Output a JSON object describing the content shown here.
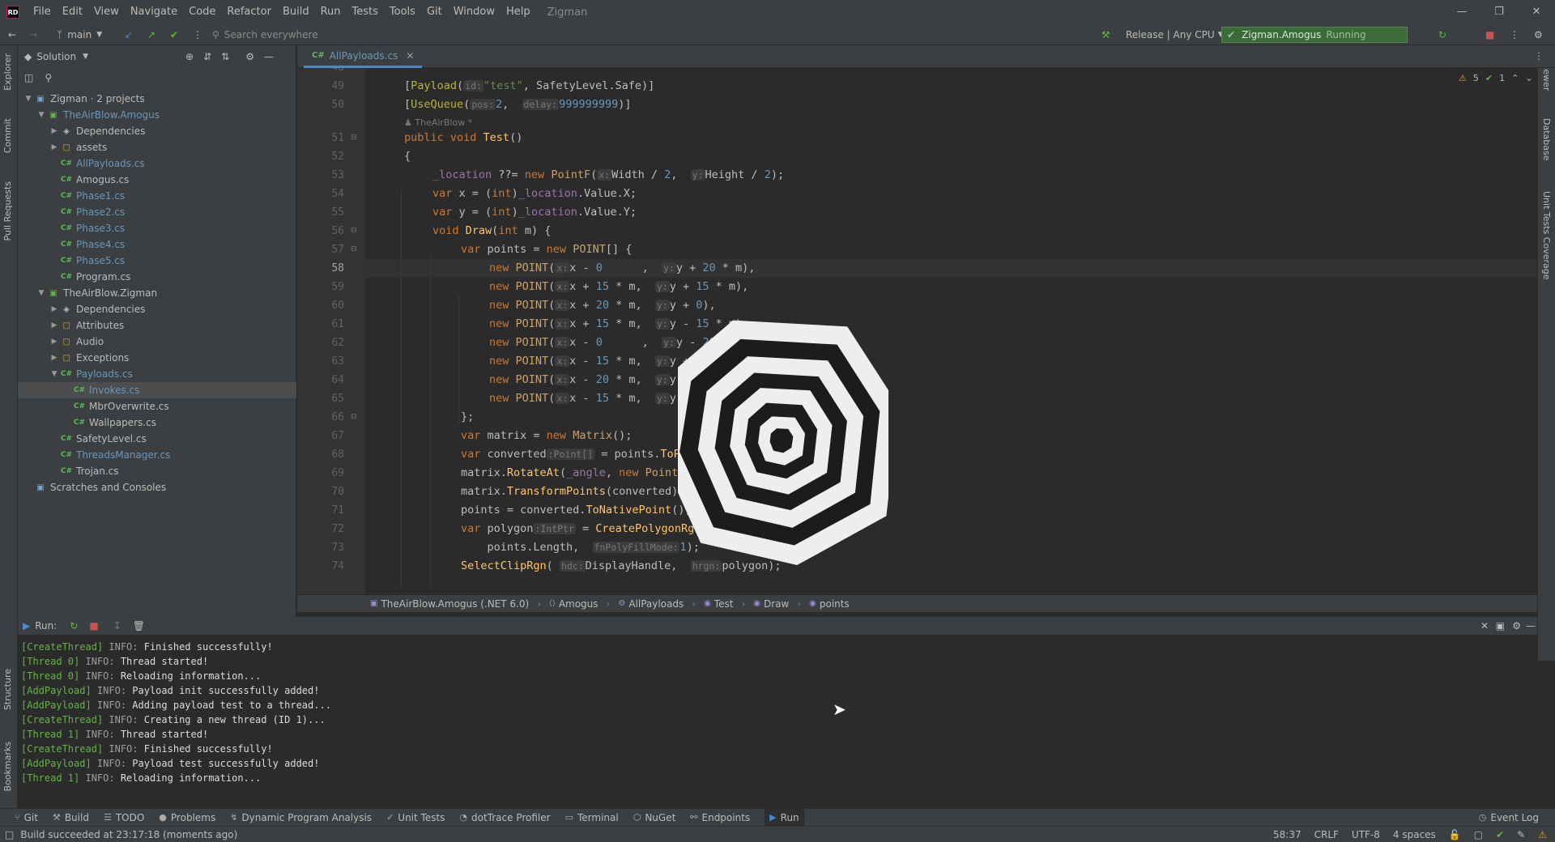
{
  "app": {
    "logo_text": "RD",
    "project_name": "Zigman"
  },
  "menu": [
    "File",
    "Edit",
    "View",
    "Navigate",
    "Code",
    "Refactor",
    "Build",
    "Run",
    "Tests",
    "Tools",
    "Git",
    "Window",
    "Help"
  ],
  "toolbar": {
    "branch": "main",
    "search_placeholder": "Search everywhere",
    "build_config": "Release | Any CPU",
    "run_config": "Zigman.Amogus",
    "run_state": "Running"
  },
  "left_strip": [
    "Explorer",
    "Commit",
    "Pull Requests",
    "Structure",
    "Bookmarks"
  ],
  "right_strip": [
    "IL Viewer",
    "Database",
    "Unit Tests Coverage"
  ],
  "solution": {
    "title": "Solution",
    "tree": [
      {
        "label": "Zigman · 2 projects",
        "depth": 0,
        "icon": "solution",
        "expanded": true
      },
      {
        "label": "TheAirBlow.Amogus",
        "depth": 1,
        "icon": "project",
        "expanded": true,
        "color": "blue"
      },
      {
        "label": "Dependencies",
        "depth": 2,
        "icon": "deps",
        "expanded": false
      },
      {
        "label": "assets",
        "depth": 2,
        "icon": "folder",
        "expanded": false
      },
      {
        "label": "AllPayloads.cs",
        "depth": 2,
        "icon": "cs",
        "color": "blue"
      },
      {
        "label": "Amogus.cs",
        "depth": 2,
        "icon": "cs"
      },
      {
        "label": "Phase1.cs",
        "depth": 2,
        "icon": "cs",
        "color": "blue"
      },
      {
        "label": "Phase2.cs",
        "depth": 2,
        "icon": "cs",
        "color": "blue"
      },
      {
        "label": "Phase3.cs",
        "depth": 2,
        "icon": "cs",
        "color": "blue"
      },
      {
        "label": "Phase4.cs",
        "depth": 2,
        "icon": "cs",
        "color": "blue"
      },
      {
        "label": "Phase5.cs",
        "depth": 2,
        "icon": "cs",
        "color": "blue"
      },
      {
        "label": "Program.cs",
        "depth": 2,
        "icon": "cs"
      },
      {
        "label": "TheAirBlow.Zigman",
        "depth": 1,
        "icon": "project",
        "expanded": true
      },
      {
        "label": "Dependencies",
        "depth": 2,
        "icon": "deps",
        "expanded": false
      },
      {
        "label": "Attributes",
        "depth": 2,
        "icon": "folder",
        "expanded": false
      },
      {
        "label": "Audio",
        "depth": 2,
        "icon": "folder",
        "expanded": false
      },
      {
        "label": "Exceptions",
        "depth": 2,
        "icon": "folder",
        "expanded": false
      },
      {
        "label": "Payloads.cs",
        "depth": 2,
        "icon": "cs",
        "expanded": true,
        "color": "blue"
      },
      {
        "label": "Invokes.cs",
        "depth": 3,
        "icon": "cs",
        "selected": true,
        "color": "blue"
      },
      {
        "label": "MbrOverwrite.cs",
        "depth": 3,
        "icon": "cs"
      },
      {
        "label": "Wallpapers.cs",
        "depth": 3,
        "icon": "cs"
      },
      {
        "label": "SafetyLevel.cs",
        "depth": 2,
        "icon": "cs"
      },
      {
        "label": "ThreadsManager.cs",
        "depth": 2,
        "icon": "cs",
        "color": "blue"
      },
      {
        "label": "Trojan.cs",
        "depth": 2,
        "icon": "cs"
      },
      {
        "label": "Scratches and Consoles",
        "depth": 0,
        "icon": "scratch"
      }
    ]
  },
  "editor": {
    "tab": "AllPayloads.cs",
    "tab_prefix": "C#",
    "inspections": {
      "warnings": "5",
      "ok": "1"
    },
    "current_line": 58,
    "author_hint": "TheAirBlow *",
    "lines": [
      {
        "n": 48,
        "html": ""
      },
      {
        "n": 49,
        "html": "[<span class='attr'>Payload</span>(<span class='hint'>id:</span><span class='str'>\"test\"</span>, SafetyLevel.Safe)]",
        "indent": 1
      },
      {
        "n": 50,
        "html": "[<span class='attr'>UseQueue</span>(<span class='hint'>pos:</span><span class='num'>2</span>,  <span class='hint'>delay:</span><span class='num'>999999999</span>)]",
        "indent": 1
      },
      {
        "n": null,
        "html": "<span class='authorhint'>&#9823; TheAirBlow *</span>",
        "indent": 1,
        "small": true
      },
      {
        "n": 51,
        "html": "<span class='kw'>public void</span> <span class='fn'>Test</span>()",
        "indent": 1
      },
      {
        "n": 52,
        "html": "{",
        "indent": 1
      },
      {
        "n": 53,
        "html": "<span class='field'>_location</span> ??= <span class='kw'>new</span> <span class='tp'>PointF</span>(<span class='hint'>x:</span>Width / <span class='num'>2</span>,  <span class='hint'>y:</span>Height / <span class='num'>2</span>);",
        "indent": 2
      },
      {
        "n": 54,
        "html": "<span class='kw'>var</span> x = (<span class='kw'>int</span>)<span class='field'>_location</span>.Value.X;",
        "indent": 2
      },
      {
        "n": 55,
        "html": "<span class='kw'>var</span> y = (<span class='kw'>int</span>)<span class='field'>_location</span>.Value.Y;",
        "indent": 2
      },
      {
        "n": 56,
        "html": "<span class='kw'>void</span> <span class='fn'>Draw</span>(<span class='kw'>int</span> m) {",
        "indent": 2
      },
      {
        "n": 57,
        "html": "<span class='kw'>var</span> points = <span class='kw'>new</span> <span class='tp'>POINT</span>[] {",
        "indent": 3
      },
      {
        "n": 58,
        "html": "<span class='kw'>new</span> <span class='tp'>POINT</span>(<span class='hint'>x:</span>x - <span class='num'>0</span>      ,  <span class='hint'>y:</span>y + <span class='num'>20</span> * m),",
        "indent": 4
      },
      {
        "n": 59,
        "html": "<span class='kw'>new</span> <span class='tp'>POINT</span>(<span class='hint'>x:</span>x + <span class='num'>15</span> * m,  <span class='hint'>y:</span>y + <span class='num'>15</span> * m),",
        "indent": 4
      },
      {
        "n": 60,
        "html": "<span class='kw'>new</span> <span class='tp'>POINT</span>(<span class='hint'>x:</span>x + <span class='num'>20</span> * m,  <span class='hint'>y:</span>y + <span class='num'>0</span>),",
        "indent": 4
      },
      {
        "n": 61,
        "html": "<span class='kw'>new</span> <span class='tp'>POINT</span>(<span class='hint'>x:</span>x + <span class='num'>15</span> * m,  <span class='hint'>y:</span>y - <span class='num'>15</span> * m),",
        "indent": 4
      },
      {
        "n": 62,
        "html": "<span class='kw'>new</span> <span class='tp'>POINT</span>(<span class='hint'>x:</span>x - <span class='num'>0</span>      ,  <span class='hint'>y:</span>y - <span class='num'>20</span> * m),",
        "indent": 4
      },
      {
        "n": 63,
        "html": "<span class='kw'>new</span> <span class='tp'>POINT</span>(<span class='hint'>x:</span>x - <span class='num'>15</span> * m,  <span class='hint'>y:</span>y + <span class='num'>15</span> * m),",
        "indent": 4
      },
      {
        "n": 64,
        "html": "<span class='kw'>new</span> <span class='tp'>POINT</span>(<span class='hint'>x:</span>x - <span class='num'>20</span> * m,  <span class='hint'>y:</span>y + <span class='num'>0</span>),",
        "indent": 4
      },
      {
        "n": 65,
        "html": "<span class='kw'>new</span> <span class='tp'>POINT</span>(<span class='hint'>x:</span>x - <span class='num'>15</span> * m,  <span class='hint'>y:</span>y + <span class='num'>15</span> * m)",
        "indent": 4
      },
      {
        "n": 66,
        "html": "};",
        "indent": 3
      },
      {
        "n": 67,
        "html": "<span class='kw'>var</span> matrix = <span class='kw'>new</span> <span class='tp'>Matrix</span>();",
        "indent": 3
      },
      {
        "n": 68,
        "html": "<span class='kw'>var</span> converted<span class='hint'>:Point[]</span> = points.<span class='fn'>ToPoint</span>();",
        "indent": 3
      },
      {
        "n": 69,
        "html": "matrix.<span class='fn'>RotateAt</span>(<span class='field'>_angle</span>, <span class='kw'>new</span> <span class='tp'>PointF</span>(x, y));",
        "indent": 3
      },
      {
        "n": 70,
        "html": "matrix.<span class='fn'>TransformPoints</span>(converted);",
        "indent": 3
      },
      {
        "n": 71,
        "html": "points = converted.<span class='fn'>ToNativePoint</span>();",
        "indent": 3
      },
      {
        "n": 72,
        "html": "<span class='kw'>var</span> polygon<span class='hint'>:IntPtr</span> = <span class='fn'>CreatePolygonRgn</span>(points,",
        "indent": 3
      },
      {
        "n": 73,
        "html": "    points.Length,  <span class='hint'>fnPolyFillMode:</span><span class='num'>1</span>);",
        "indent": 3
      },
      {
        "n": 74,
        "html": "<span class='fn'>SelectClipRgn</span>( <span class='hint'>hdc:</span>DisplayHandle,  <span class='hint'>hrgn:</span>polygon);",
        "indent": 3
      }
    ]
  },
  "breadcrumbs": [
    "TheAirBlow.Amogus (.NET 6.0)",
    "Amogus",
    "AllPayloads",
    "Test",
    "Draw",
    "points"
  ],
  "run": {
    "title": "Run:",
    "log": [
      {
        "tag": "[CreateThread]",
        "lvl": "INFO:",
        "msg": "Finished successfully!"
      },
      {
        "tag": "[Thread 0]",
        "lvl": "INFO:",
        "msg": "Thread started!"
      },
      {
        "tag": "[Thread 0]",
        "lvl": "INFO:",
        "msg": "Reloading information..."
      },
      {
        "tag": "[AddPayload]",
        "lvl": "INFO:",
        "msg": "Payload init successfully added!"
      },
      {
        "tag": "[AddPayload]",
        "lvl": "INFO:",
        "msg": "Adding payload test to a thread..."
      },
      {
        "tag": "[CreateThread]",
        "lvl": "INFO:",
        "msg": "Creating a new thread (ID 1)..."
      },
      {
        "tag": "[Thread 1]",
        "lvl": "INFO:",
        "msg": "Thread started!"
      },
      {
        "tag": "[CreateThread]",
        "lvl": "INFO:",
        "msg": "Finished successfully!"
      },
      {
        "tag": "[AddPayload]",
        "lvl": "INFO:",
        "msg": "Payload test successfully added!"
      },
      {
        "tag": "[Thread 1]",
        "lvl": "INFO:",
        "msg": "Reloading information..."
      }
    ]
  },
  "bottom_tools": [
    {
      "label": "Git",
      "icon": "git-icon",
      "glyph": "⑂"
    },
    {
      "label": "Build",
      "icon": "hammer-icon",
      "glyph": "⚒"
    },
    {
      "label": "TODO",
      "icon": "list-icon",
      "glyph": "☰"
    },
    {
      "label": "Problems",
      "icon": "problems-icon",
      "glyph": "●"
    },
    {
      "label": "Dynamic Program Analysis",
      "icon": "dpa-icon",
      "glyph": "↯"
    },
    {
      "label": "Unit Tests",
      "icon": "tests-icon",
      "glyph": "✓"
    },
    {
      "label": "dotTrace Profiler",
      "icon": "profiler-icon",
      "glyph": "◔"
    },
    {
      "label": "Terminal",
      "icon": "terminal-icon",
      "glyph": "▭"
    },
    {
      "label": "NuGet",
      "icon": "nuget-icon",
      "glyph": "⬡"
    },
    {
      "label": "Endpoints",
      "icon": "endpoints-icon",
      "glyph": "⚯"
    },
    {
      "label": "Run",
      "icon": "run-icon",
      "glyph": "▶",
      "active": true
    }
  ],
  "event_log": "Event Log",
  "status": {
    "message": "Build succeeded at 23:17:18 (moments ago)",
    "position": "58:37",
    "line_sep": "CRLF",
    "encoding": "UTF-8",
    "indent": "4 spaces"
  },
  "colors": {
    "run_green": "#3d6a3b",
    "accent": "#4a88c7",
    "cs_green": "#5fb760"
  }
}
